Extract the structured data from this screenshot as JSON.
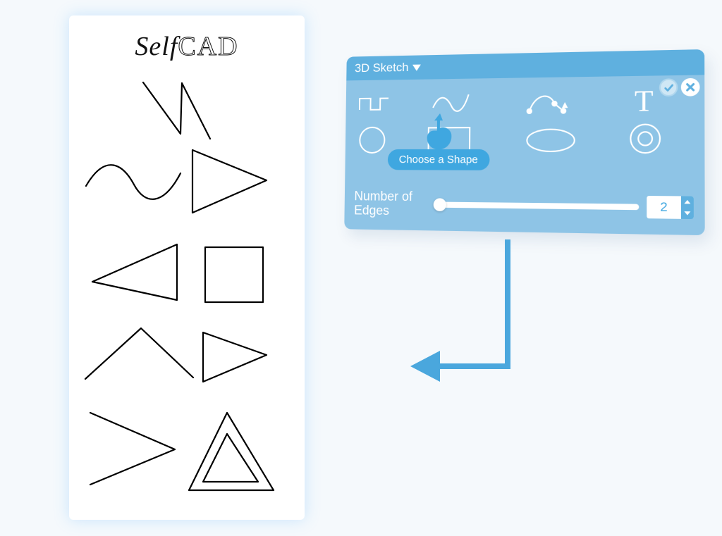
{
  "card": {
    "brand_self": "Self",
    "brand_cad": "CAD"
  },
  "panel": {
    "title": "3D Sketch",
    "tooltip": "Choose a Shape",
    "slider_label": "Number of Edges",
    "edges_value": "2",
    "tools": {
      "step": "step-line",
      "spline": "free-spline",
      "bezier": "bezier-path",
      "text": "T",
      "circle": "circle",
      "rect": "rectangle",
      "ellipse": "ellipse",
      "ring": "ring"
    }
  }
}
